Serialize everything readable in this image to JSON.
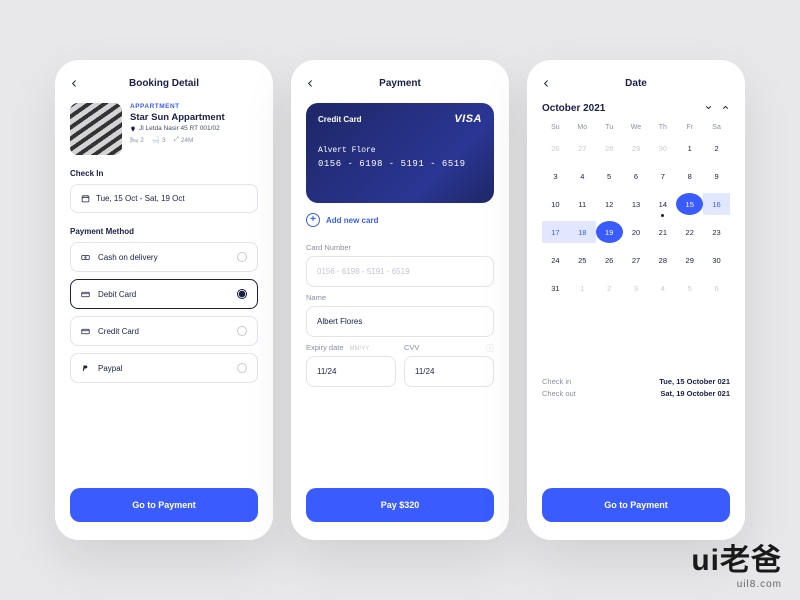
{
  "booking": {
    "title": "Booking Detail",
    "tag": "APPARTMENT",
    "name": "Star Sun Appartment",
    "address": "Jl Letda Nasir 45 RT 001/02",
    "amenities": {
      "beds": "2",
      "baths": "3",
      "area": "24M"
    },
    "checkin_label": "Check In",
    "date_value": "Tue, 15 Oct - Sat, 19 Oct",
    "method_label": "Payment Method",
    "methods": [
      {
        "label": "Cash on delivery"
      },
      {
        "label": "Debit Card"
      },
      {
        "label": "Credit Card"
      },
      {
        "label": "Paypal"
      }
    ],
    "cta": "Go to Payment"
  },
  "payment": {
    "title": "Payment",
    "card": {
      "type": "Credit Card",
      "brand": "VISA",
      "name": "Alvert Flore",
      "number": "0156 - 6198 - 5191 - 6519"
    },
    "add": "Add new card",
    "num_label": "Card Number",
    "num_value": "0156 - 6198 - 5191 - 6519",
    "name_label": "Name",
    "name_value": "Albert Flores",
    "exp_label": "Expiry date",
    "exp_hint": "MM/YY",
    "exp_value": "11/24",
    "cvv_label": "CVV",
    "cvv_value": "11/24",
    "cta": "Pay $320"
  },
  "date": {
    "title": "Date",
    "month": "October 2021",
    "dow": [
      "Su",
      "Mo",
      "Tu",
      "We",
      "Th",
      "Fr",
      "Sa"
    ],
    "checkin_label": "Check in",
    "checkin_value": "Tue, 15 October 021",
    "checkout_label": "Check out",
    "checkout_value": "Sat, 19 October 021",
    "cta": "Go to Payment"
  },
  "watermark": {
    "chars": "ui老爸",
    "url": "uil8.com"
  }
}
